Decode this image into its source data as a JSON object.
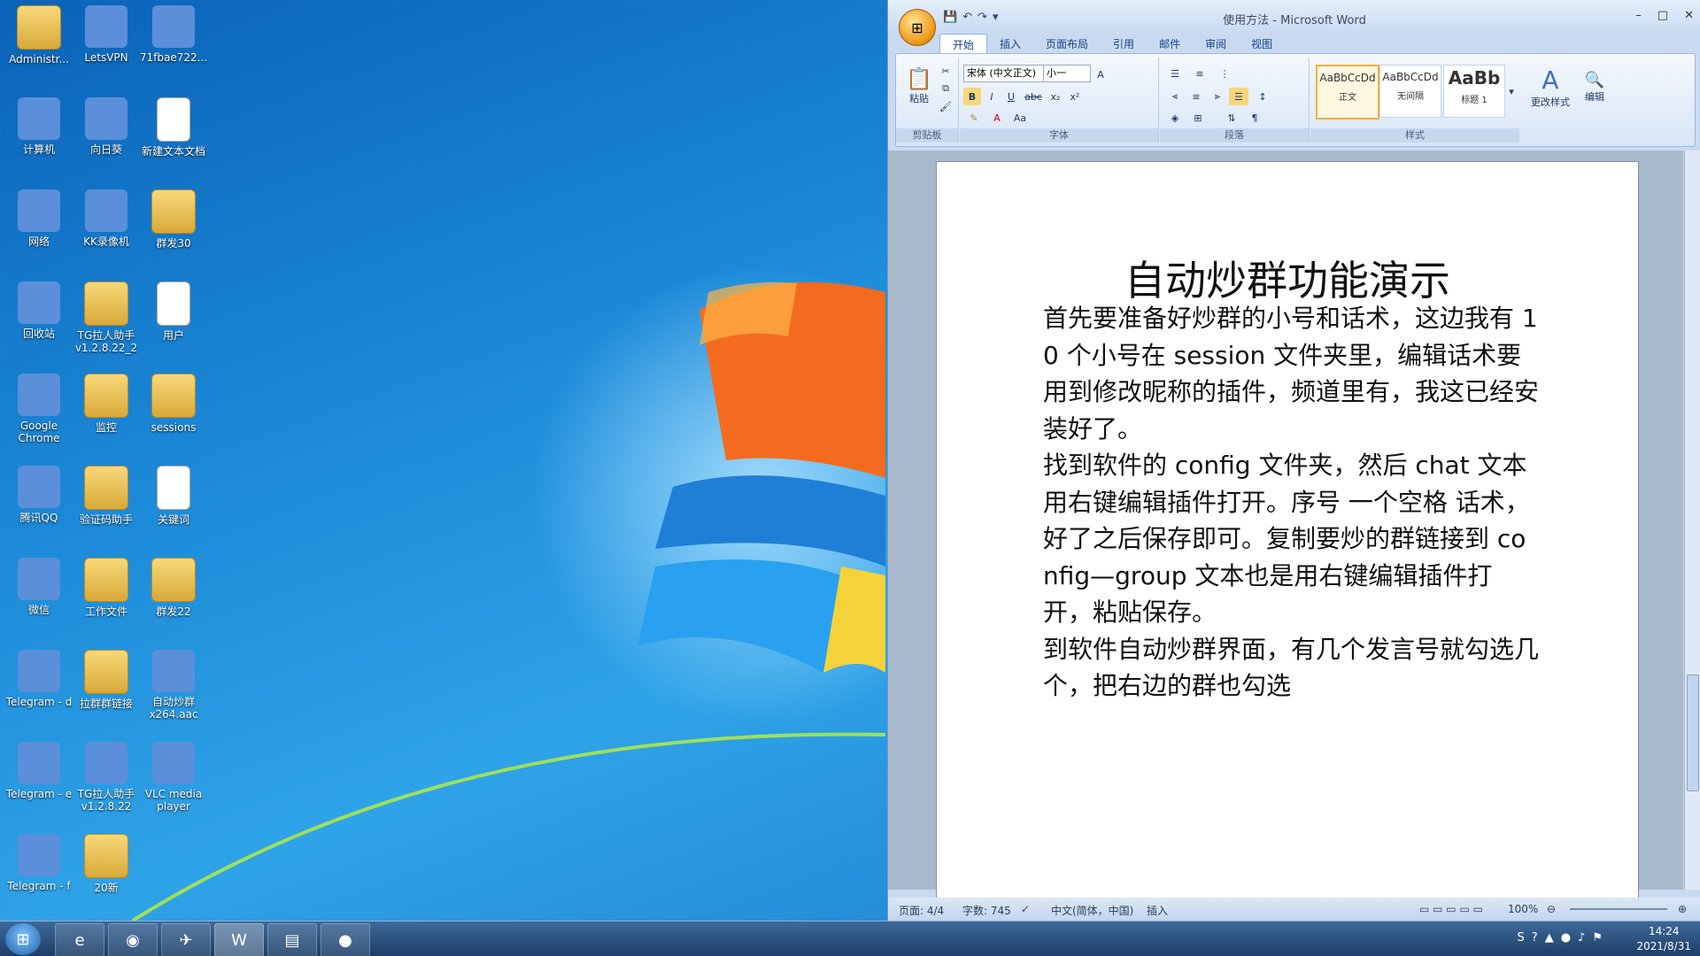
{
  "desktop": {
    "icons": [
      {
        "label": "Administr...",
        "icon": "user-folder-icon"
      },
      {
        "label": "LetsVPN",
        "icon": "vpn-icon"
      },
      {
        "label": "71fbae722...",
        "icon": "image-file-icon"
      },
      {
        "label": "计算机",
        "icon": "computer-icon"
      },
      {
        "label": "向日葵",
        "icon": "sunflower-remote-icon"
      },
      {
        "label": "新建文本文档",
        "icon": "text-file-icon"
      },
      {
        "label": "网络",
        "icon": "network-icon"
      },
      {
        "label": "KK录像机",
        "icon": "kk-recorder-icon"
      },
      {
        "label": "群发30",
        "icon": "folder-icon"
      },
      {
        "label": "回收站",
        "icon": "recycle-bin-icon"
      },
      {
        "label": "TG拉人助手 v1.2.8.22_2",
        "icon": "folder-icon"
      },
      {
        "label": "用户",
        "icon": "text-file-icon"
      },
      {
        "label": "Google Chrome",
        "icon": "chrome-icon"
      },
      {
        "label": "监控",
        "icon": "folder-icon"
      },
      {
        "label": "sessions",
        "icon": "folder-icon"
      },
      {
        "label": "腾讯QQ",
        "icon": "qq-icon"
      },
      {
        "label": "验证码助手",
        "icon": "folder-icon"
      },
      {
        "label": "关键词",
        "icon": "text-file-icon"
      },
      {
        "label": "微信",
        "icon": "wechat-icon"
      },
      {
        "label": "工作文件",
        "icon": "folder-icon"
      },
      {
        "label": "群发22",
        "icon": "folder-icon"
      },
      {
        "label": "Telegram - d",
        "icon": "telegram-icon"
      },
      {
        "label": "拉群群链接",
        "icon": "folder-icon"
      },
      {
        "label": "自动炒群 x264.aac",
        "icon": "video-file-icon"
      },
      {
        "label": "Telegram - e",
        "icon": "telegram-icon"
      },
      {
        "label": "TG拉人助手 v1.2.8.22",
        "icon": "winrar-icon"
      },
      {
        "label": "VLC media player",
        "icon": "vlc-icon"
      },
      {
        "label": "Telegram - f",
        "icon": "telegram-icon"
      },
      {
        "label": "20新",
        "icon": "folder-icon"
      }
    ]
  },
  "word": {
    "title": "使用方法 - Microsoft Word",
    "tabs": [
      "开始",
      "插入",
      "页面布局",
      "引用",
      "邮件",
      "审阅",
      "视图"
    ],
    "ribbon": {
      "paste_label": "粘贴",
      "font_name": "宋体 (中文正文)",
      "font_size": "小一",
      "groups": [
        "剪贴板",
        "字体",
        "段落",
        "样式"
      ],
      "styles": [
        {
          "preview": "AaBbCcDd",
          "name": "正文"
        },
        {
          "preview": "AaBbCcDd",
          "name": "无间隔"
        },
        {
          "preview": "AaBb",
          "name": "标题 1"
        }
      ],
      "change_styles": "更改样式",
      "edit": "编辑"
    },
    "document": {
      "title": "自动炒群功能演示",
      "paragraphs": [
        "首先要准备好炒群的小号和话术，这边我有 10 个小号在 session 文件夹里，编辑话术要用到修改昵称的插件，频道里有，我这已经安装好了。",
        "找到软件的 config 文件夹，然后 chat 文本用右键编辑插件打开。序号  一个空格 话术，好了之后保存即可。复制要炒的群链接到 config—group 文本也是用右键编辑插件打开，粘贴保存。",
        "到软件自动炒群界面，有几个发言号就勾选几个，把右边的群也勾选"
      ]
    },
    "status": {
      "page": "页面: 4/4",
      "words": "字数: 745",
      "language": "中文(简体，中国)",
      "mode": "插入",
      "zoom": "100%"
    }
  },
  "taskbar": {
    "time": "14:24",
    "date": "2021/8/31"
  }
}
